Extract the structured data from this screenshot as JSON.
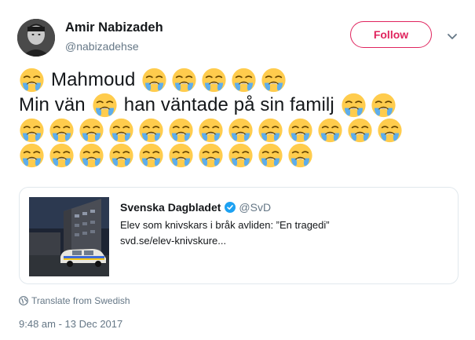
{
  "author": {
    "name": "Amir Nabizadeh",
    "handle": "@nabizadehse"
  },
  "follow_button": {
    "label": "Follow"
  },
  "tweet": {
    "line1": {
      "emoji_before": 1,
      "word": "Mahmoud",
      "emoji_after": 5
    },
    "line2": {
      "word1": "Min vän",
      "emoji_mid": 1,
      "word2": "han väntade på sin familj",
      "emoji_after": 2
    },
    "line3_emoji": 13,
    "line4_emoji": 10,
    "emoji_name": "loudly-crying-face"
  },
  "quoted_card": {
    "source_name": "Svenska Dagbladet",
    "source_handle": "@SvD",
    "title": "Elev som knivskars i bråk avliden: ”En tragedi”",
    "url": "svd.se/elev-knivskure..."
  },
  "translate_label": "Translate from Swedish",
  "timestamp": "9:48 am - 13 Dec 2017",
  "colors": {
    "follow_accent": "#e0245e",
    "secondary_text": "#657786",
    "verified_blue": "#1da1f2",
    "border": "#e1e8ed"
  }
}
